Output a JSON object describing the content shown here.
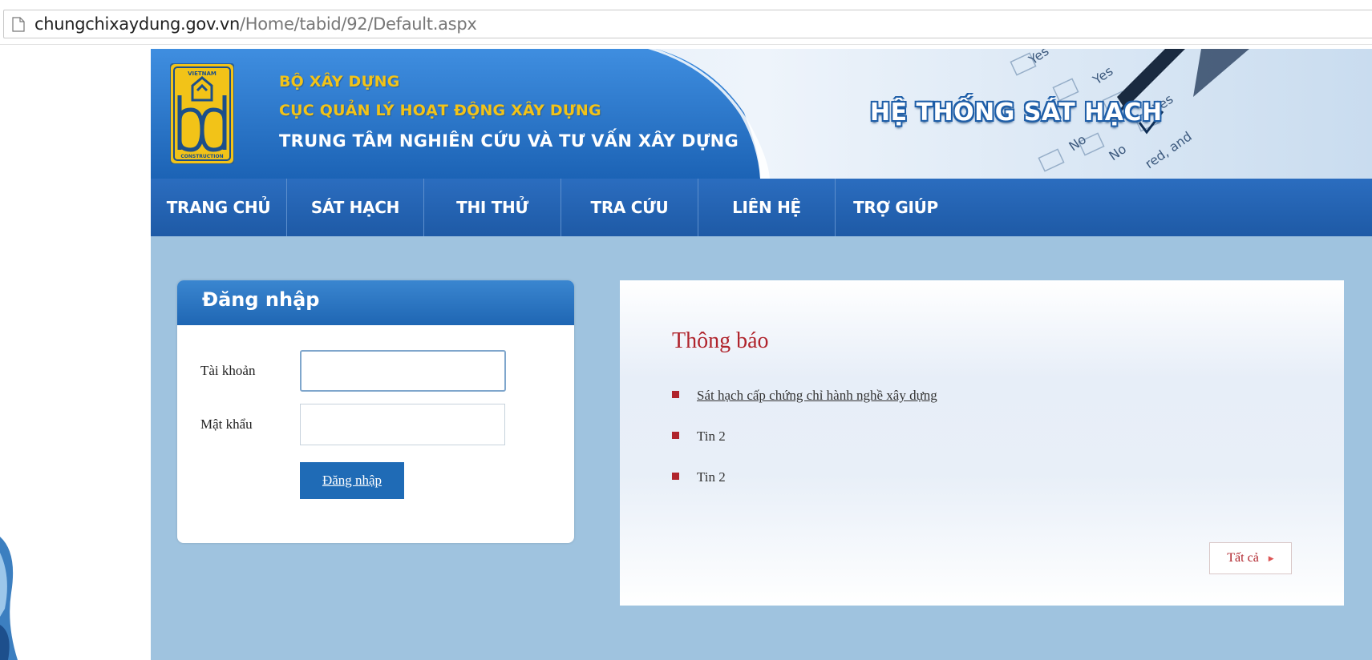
{
  "browser": {
    "url_host": "chungchixaydung.gov.vn",
    "url_path": "/Home/tabid/92/Default.aspx",
    "page_icon": "document-icon"
  },
  "header": {
    "logo_top": "VIETNAM",
    "logo_bottom": "CONSTRUCTION",
    "org_line1": "BỘ XÂY DỰNG",
    "org_line2": "CỤC QUẢN LÝ HOẠT ĐỘNG XÂY DỰNG",
    "org_line3": "TRUNG TÂM NGHIÊN CỨU VÀ TƯ VẤN XÂY DỰNG",
    "system_title": "HỆ THỐNG SÁT HẠCH",
    "checklist_words": [
      "Yes",
      "Yes",
      "Yes",
      "No",
      "No",
      "red, and"
    ]
  },
  "nav": {
    "items": [
      {
        "label": "TRANG CHỦ"
      },
      {
        "label": "SÁT HẠCH"
      },
      {
        "label": "THI THỬ"
      },
      {
        "label": "TRA CỨU"
      },
      {
        "label": "LIÊN HỆ"
      },
      {
        "label": "TRỢ GIÚP"
      }
    ]
  },
  "login": {
    "title": "Đăng nhập",
    "username_label": "Tài khoản",
    "username_value": "",
    "password_label": "Mật khẩu",
    "password_value": "",
    "submit_label": "Đăng nhập"
  },
  "news": {
    "title": "Thông báo",
    "items": [
      {
        "text": "Sát hạch cấp chứng chỉ hành nghề xây dựng"
      },
      {
        "text": "Tin 2"
      },
      {
        "text": "Tin 2"
      }
    ],
    "all_label": "Tất cả"
  },
  "colors": {
    "brand_blue": "#1f66b3",
    "accent_red": "#b0242c",
    "page_bg": "#9fc3df",
    "gold": "#f2c318"
  }
}
